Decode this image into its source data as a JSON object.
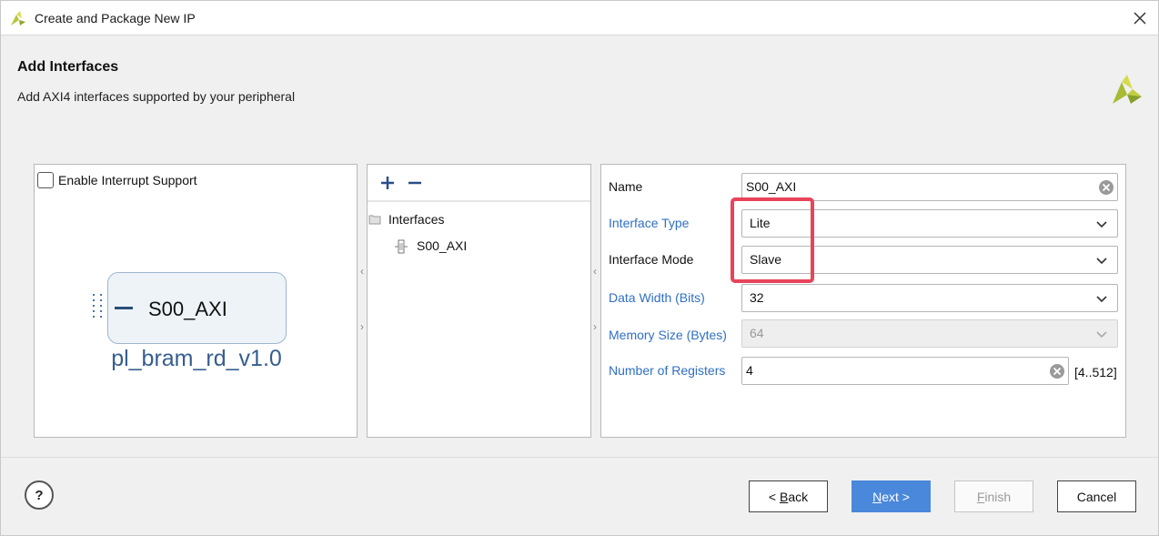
{
  "window": {
    "title": "Create and Package New IP"
  },
  "header": {
    "title": "Add Interfaces",
    "subtitle": "Add AXI4 interfaces supported by your peripheral"
  },
  "left_panel": {
    "interrupt_checkbox_label": "Enable Interrupt Support",
    "interrupt_checked": false,
    "ip_block": {
      "port_label": "S00_AXI",
      "ip_name": "pl_bram_rd_v1.0"
    }
  },
  "middle_panel": {
    "tree": {
      "root_label": "Interfaces",
      "children": [
        "S00_AXI"
      ]
    }
  },
  "right_panel": {
    "fields": {
      "name": {
        "label": "Name",
        "value": "S00_AXI"
      },
      "interface_type": {
        "label": "Interface Type",
        "value": "Lite"
      },
      "interface_mode": {
        "label": "Interface Mode",
        "value": "Slave"
      },
      "data_width": {
        "label": "Data Width (Bits)",
        "value": "32"
      },
      "memory_size": {
        "label": "Memory Size (Bytes)",
        "value": "64"
      },
      "num_registers": {
        "label": "Number of Registers",
        "value": "4",
        "range": "[4..512]"
      }
    }
  },
  "footer": {
    "help": "?",
    "back_mnemonic": "B",
    "back_rest": "ack",
    "back_prefix": "< ",
    "next_mnemonic": "N",
    "next_rest": "ext >",
    "finish_mnemonic": "F",
    "finish_rest": "inish",
    "cancel": "Cancel"
  },
  "colors": {
    "link_label": "#2f6fc6",
    "primary_button": "#4a88db",
    "highlight": "#e8445a",
    "ip_name": "#365e8e"
  }
}
